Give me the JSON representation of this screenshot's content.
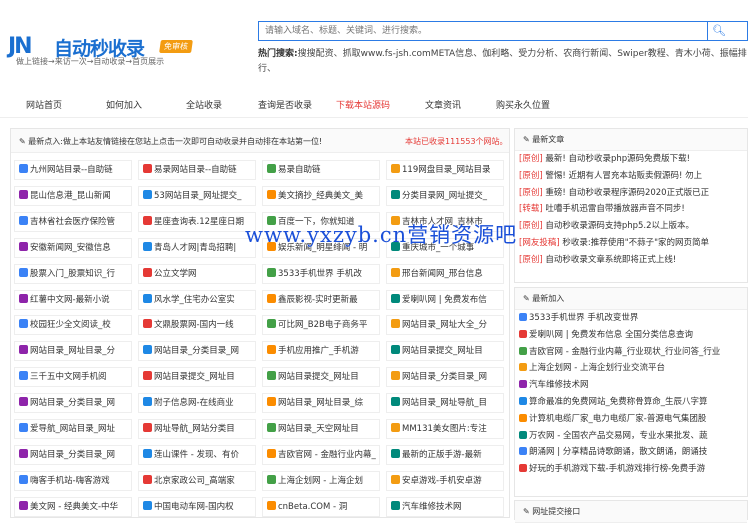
{
  "logo": {
    "mark": "JN",
    "title": "自动秒收录",
    "badge": "免审核",
    "slogan": "做上链接→来访一次→自动收录→首页展示"
  },
  "search": {
    "placeholder": "请输入域名、标题、关键词、进行搜索。",
    "button_icon": "search-icon"
  },
  "hot": {
    "label": "热门搜索:",
    "text": "搜搜配资、抓取www.fs-jsh.comMETA信息、伽利略、受力分析、农商行新闻、Swiper教程、青木小荷、振幅排行、"
  },
  "nav": {
    "items": [
      "网站首页",
      "如何加入",
      "全站收录",
      "查询是否收录",
      "下载本站源码",
      "文章资讯",
      "购买永久位置"
    ],
    "active_index": 4
  },
  "notice": {
    "left": "✎ 最新点入:做上本站友情链接在您站上点击一次即可自动收录并自动排在本站第一位!",
    "right": "本站已收录111553个网站。"
  },
  "grid": [
    [
      "九州网站目录--自助链",
      "易录网站目录--自助链",
      "易录自助链",
      "119网盘目录_网站目录"
    ],
    [
      "昆山信息港_昆山新闻",
      "53网站目录_网址提交_",
      "美文摘抄_经典美文_美",
      "分类目录网_网址提交_"
    ],
    [
      "吉林省社会医疗保险管",
      "星座查询表.12星座日期",
      "百度一下，你就知道",
      "吉林市人才网_吉林市"
    ],
    [
      "安徽新闻网_安徽信息",
      "青岛人才网|青岛招聘|",
      "娱乐新闻_明星绯闻 - 明",
      "重庆城市_一个城事"
    ],
    [
      "股票入门_股票知识_行",
      "公立文学网",
      "3533手机世界 手机改",
      "邢台新闻网_邢台信息"
    ],
    [
      "红薯中文网-最新小说",
      "风水学_住宅办公室实",
      "鑫辰影视-实时更新最",
      "爱喇叭网 | 免费发布信"
    ],
    [
      "校园狂少全文阅读_校",
      "文鼎股票网-国内一线",
      "可比网_B2B电子商务平",
      "网站目录_网址大全_分"
    ],
    [
      "网站目录_网址目录_分",
      "网站目录_分类目录_网",
      "手机应用推广_手机游",
      "网站目录提交_网址目"
    ],
    [
      "三千五中文网手机阅",
      "网站目录提交_网址目",
      "网站目录提交_网址目",
      "网站目录_分类目录_网"
    ],
    [
      "网站目录_分类目录_网",
      "附子信息网-在线商业",
      "网站目录_网址目录_综",
      "网站目录_网址导航_目"
    ],
    [
      "爱导航_网站目录_网址",
      "网址导航_网站分类目",
      "网站目录_天空网址目",
      "MM131美女图片:专注"
    ],
    [
      "网站目录_分类目录_网",
      "莲山课件 - 发现、有价",
      "吉欧官网 - 金融行业内幕_",
      "最新的正版手游-最新"
    ],
    [
      "嗨客手机站-嗨客游戏",
      "北京家政公司_高端家",
      "上海企划网 - 上海企划",
      "安卓游戏-手机安卓游"
    ],
    [
      "美文网 - 经典美文-中华",
      "中国电动车网-国内权",
      "cnBeta.COM - 洞",
      "汽车维修技术网"
    ]
  ],
  "icon_colors": [
    "#3b82f6",
    "#e53935",
    "#43a047",
    "#f39c12",
    "#8e24aa",
    "#1e88e5",
    "#fb8c00",
    "#00897b"
  ],
  "side1": {
    "title": "✎ 最新文章",
    "items": [
      {
        "tag": "[原创]",
        "text": "最新! 自动秒收录php源码免费版下载!"
      },
      {
        "tag": "[原创]",
        "text": "警惕! 近期有人冒充本站贩卖假源码! 勿上"
      },
      {
        "tag": "[原创]",
        "text": "重磅! 自动秒收录程序源码2020正式版已正"
      },
      {
        "tag": "[转载]",
        "text": "吐嘈手机迅雷自带播放器声音不同步!"
      },
      {
        "tag": "[原创]",
        "text": "自动秒收录源码支持php5.2以上版本。"
      },
      {
        "tag": "[网友投稿]",
        "text": "秒收录:推荐使用\"不蒜子\"家的网页简单"
      },
      {
        "tag": "[原创]",
        "text": "自动秒收录文章系统即将正式上线!"
      }
    ]
  },
  "side2": {
    "title": "✎ 最新加入",
    "items": [
      "3533手机世界 手机改变世界",
      "爱喇叭网 | 免费发布信息 全国分类信息查询",
      "吉欧官网 - 金融行业内幕_行业现状_行业问答_行业",
      "上海企划网 - 上海企划行业交流平台",
      "汽车维修技术网",
      "算命最准的免费网站_免费称骨算命_生辰八字算",
      "计算机电缆厂家_电力电缆厂家-普源电气集团股",
      "万农网 - 全国农产品交易网，专业水果批发、蔬",
      "朗涌网 | 分享精品诗歌朗诵，散文朗诵，朗诵技",
      "好玩的手机游戏下载-手机游戏排行榜-免费手游"
    ]
  },
  "side3": {
    "title": "✎ 网址提交接口"
  },
  "watermark": "www.yxzyb.cn营销资源吧"
}
